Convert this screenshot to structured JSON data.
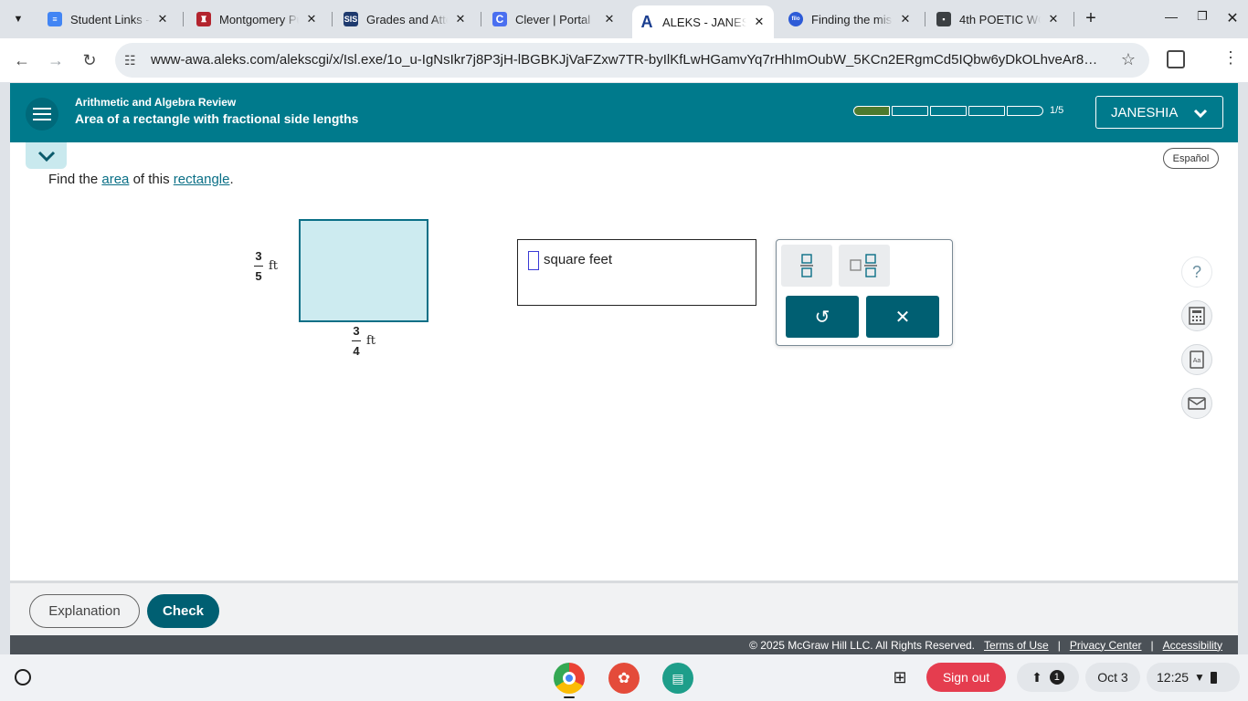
{
  "browser": {
    "tabs": [
      {
        "title": "Student Links - C",
        "icon": "google-docs-icon",
        "color": "#4285f4"
      },
      {
        "title": "Montgomery Pub",
        "icon": "school-crest-icon",
        "color": "#b3242e"
      },
      {
        "title": "Grades and Atte",
        "icon": "sis-icon",
        "color": "#1e3a6e",
        "glyph": "SIS"
      },
      {
        "title": "Clever | Portal",
        "icon": "clever-icon",
        "color": "#4a6ff0",
        "glyph": "C"
      },
      {
        "title": "ALEKS - JANESH",
        "icon": "aleks-icon",
        "color": "#1a3d8f",
        "glyph": "A",
        "active": true
      },
      {
        "title": "Finding the mis",
        "icon": "filo-icon",
        "color": "#2d5bd7",
        "glyph": "filo"
      },
      {
        "title": "4th POETIC WO",
        "icon": "classroom-icon",
        "color": "#3c4043"
      }
    ],
    "url": "www-awa.aleks.com/alekscgi/x/Isl.exe/1o_u-IgNsIkr7j8P3jH-lBGBKJjVaFZxw7TR-byIlKfLwHGamvYq7rHhImOubW_5KCn2ERgmCd5IQbw6yDkOLhveAr89jG2T..."
  },
  "header": {
    "subtitle": "Arithmetic and Algebra Review",
    "title": "Area of a rectangle with fractional side lengths",
    "progress_done": 1,
    "progress_total": 5,
    "progress_label": "1/5",
    "user": "JANESHIA"
  },
  "espanol": "Español",
  "question": {
    "pre": "Find the ",
    "link1": "area",
    "mid": " of this ",
    "link2": "rectangle",
    "post": "."
  },
  "figure": {
    "height": {
      "num": "3",
      "den": "5",
      "unit": "ft"
    },
    "width": {
      "num": "3",
      "den": "4",
      "unit": "ft"
    },
    "fill": "#cdebf0",
    "stroke": "#0a6f86"
  },
  "answer": {
    "unit": "square feet"
  },
  "keypad": {
    "undo": "↺",
    "clear": "✕"
  },
  "side_tools": {
    "help": "?"
  },
  "footer": {
    "explanation": "Explanation",
    "check": "Check",
    "copyright": "© 2025 McGraw Hill LLC. All Rights Reserved.",
    "terms": "Terms of Use",
    "privacy": "Privacy Center",
    "accessibility": "Accessibility"
  },
  "shelf": {
    "signout": "Sign out",
    "notif_count": "1",
    "date": "Oct 3",
    "time": "12:25"
  }
}
